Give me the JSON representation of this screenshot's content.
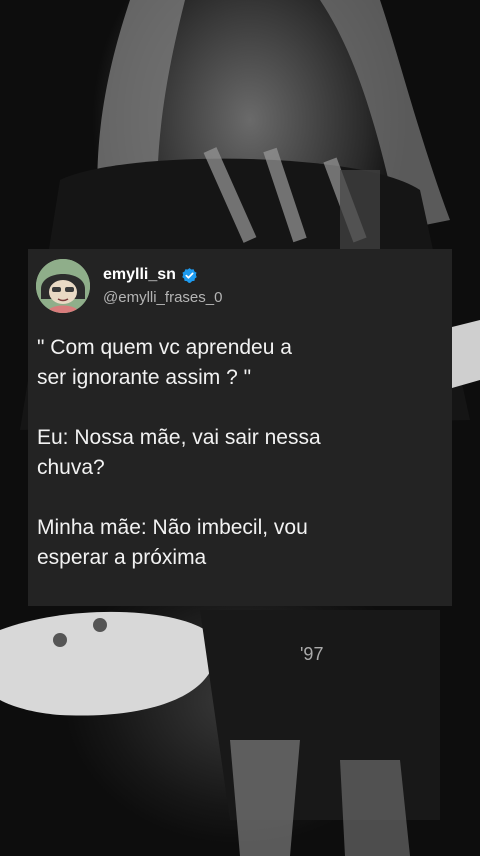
{
  "post": {
    "display_name": "emylli_sn",
    "handle": "@emylli_frases_0",
    "verified": true,
    "accent": "#1d9bf0",
    "lines": [
      "\" Com quem vc aprendeu a",
      "ser ignorante assim ? \"",
      "Eu: Nossa mãe, vai sair nessa",
      "chuva?",
      "Minha mãe: Não imbecil, vou",
      "esperar a próxima"
    ]
  }
}
